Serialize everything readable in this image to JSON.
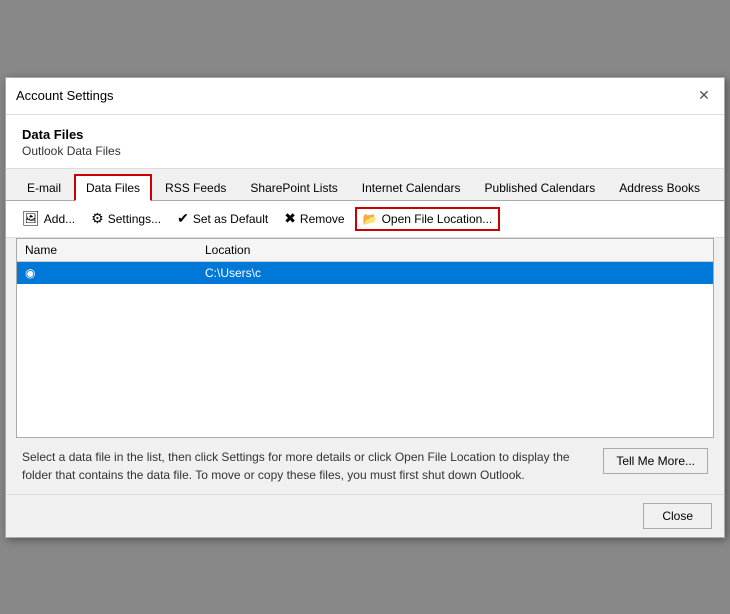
{
  "titleBar": {
    "title": "Account Settings",
    "closeIcon": "✕"
  },
  "header": {
    "sectionTitle": "Data Files",
    "sectionSub": "Outlook Data Files"
  },
  "tabs": [
    {
      "id": "email",
      "label": "E-mail",
      "active": false
    },
    {
      "id": "datafiles",
      "label": "Data Files",
      "active": true
    },
    {
      "id": "rssfeeds",
      "label": "RSS Feeds",
      "active": false
    },
    {
      "id": "sharepointlists",
      "label": "SharePoint Lists",
      "active": false
    },
    {
      "id": "internetcalendars",
      "label": "Internet Calendars",
      "active": false
    },
    {
      "id": "publishedcalendars",
      "label": "Published Calendars",
      "active": false
    },
    {
      "id": "addressbooks",
      "label": "Address Books",
      "active": false
    }
  ],
  "toolbar": {
    "addLabel": "Add...",
    "settingsLabel": "Settings...",
    "setDefaultLabel": "Set as Default",
    "removeLabel": "Remove",
    "openFileLabel": "Open File Location...",
    "addIcon": "🖼",
    "settingsIcon": "⚙",
    "setDefaultIcon": "✔",
    "removeIcon": "✖",
    "folderIcon": "📂"
  },
  "table": {
    "colName": "Name",
    "colLocation": "Location",
    "rows": [
      {
        "name": "",
        "location": "C:\\Users\\c",
        "icon": "◉"
      }
    ]
  },
  "footer": {
    "text": "Select a data file in the list, then click Settings for more details or click Open File Location to display the folder that contains the data file. To move or copy these files, you must first shut down Outlook.",
    "tellMoreLabel": "Tell Me More..."
  },
  "dialogFooter": {
    "closeLabel": "Close"
  }
}
